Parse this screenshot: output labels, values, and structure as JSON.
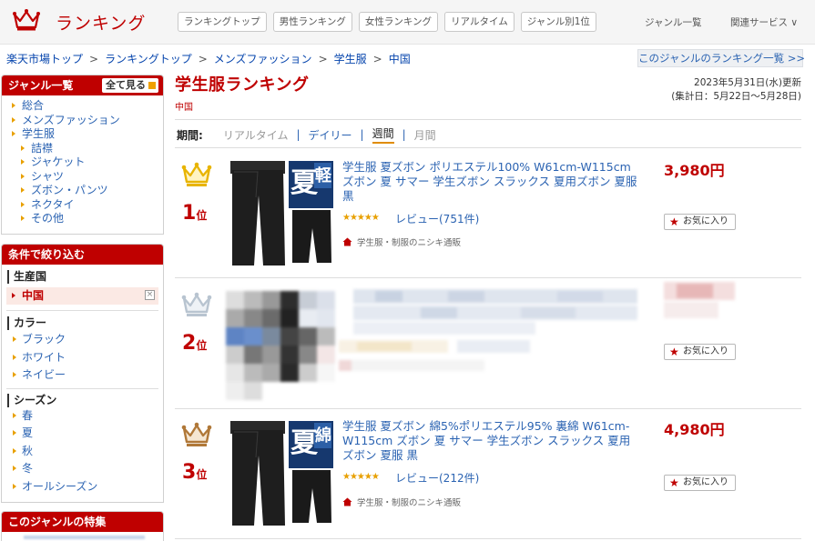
{
  "header": {
    "title": "ランキング",
    "nav": [
      "ランキングトップ",
      "男性ランキング",
      "女性ランキング",
      "リアルタイム",
      "ジャンル別1位"
    ],
    "genre_list": "ジャンル一覧",
    "related": "関連サービス ∨"
  },
  "breadcrumb": [
    "楽天市場トップ",
    "ランキングトップ",
    "メンズファッション",
    "学生服",
    "中国"
  ],
  "breadcrumb_sep": ">",
  "genre_ranking_link": "このジャンルのランキング一覧 >>",
  "sidebar": {
    "genre_heading": "ジャンル一覧",
    "see_all": "全て見る",
    "genres": [
      "総合",
      "メンズファッション",
      "学生服"
    ],
    "subgenres": [
      "詰襟",
      "ジャケット",
      "シャツ",
      "ズボン・パンツ",
      "ネクタイ",
      "その他"
    ],
    "filter_heading": "条件で絞り込む",
    "origin_title": "生産国",
    "origin_selected": "中国",
    "origin_clear": "×",
    "color_title": "カラー",
    "colors": [
      "ブラック",
      "ホワイト",
      "ネイビー"
    ],
    "season_title": "シーズン",
    "seasons": [
      "春",
      "夏",
      "秋",
      "冬",
      "オールシーズン"
    ],
    "feature_heading": "このジャンルの特集"
  },
  "main": {
    "title": "学生服ランキング",
    "subtitle": "中国",
    "updated": "2023年5月31日(水)更新",
    "period_range": "(集計日：5月22日〜5月28日)",
    "period_label": "期間:",
    "periods": [
      "リアルタイム",
      "デイリー",
      "週間",
      "月間"
    ],
    "period_sep": "|",
    "active_period": "週間"
  },
  "items": [
    {
      "rank": "1",
      "rank_suffix": "位",
      "title": "学生服 夏ズボン ポリエステル100% W61cm-W115cm ズボン 夏 サマー 学生ズボン スラックス 夏用ズボン 夏服 黒",
      "price": "3,980円",
      "stars": "★★★★★",
      "reviews": "レビュー(751件)",
      "shop": "学生服・制服のニシキ通販",
      "fav": "お気に入り",
      "badge_big": "夏",
      "badge_side": "軽"
    },
    {
      "rank": "2",
      "rank_suffix": "位",
      "fav": "お気に入り"
    },
    {
      "rank": "3",
      "rank_suffix": "位",
      "title": "学生服 夏ズボン 綿5%ポリエステル95% 裏綿 W61cm-W115cm ズボン 夏 サマー 学生ズボン スラックス 夏用ズボン 夏服 黒",
      "price": "4,980円",
      "stars": "★★★★★",
      "reviews": "レビュー(212件)",
      "shop": "学生服・制服のニシキ通販",
      "fav": "お気に入り",
      "badge_big": "夏",
      "badge_side": "綿"
    }
  ],
  "colors": {
    "brand_red": "#bf0000",
    "gold": "#e8b400",
    "silver": "#b8c4d0",
    "bronze": "#b07838",
    "link": "#2b63b2"
  }
}
